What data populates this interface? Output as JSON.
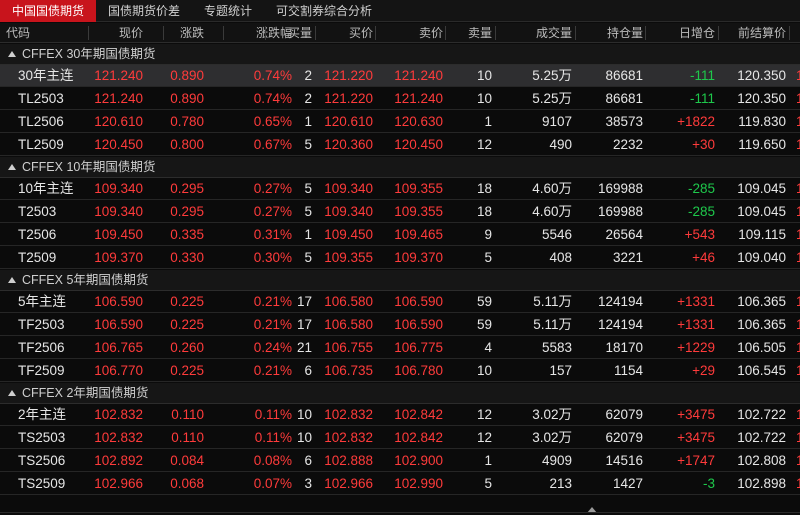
{
  "tabs": [
    {
      "label": "中国国债期货",
      "active": true
    },
    {
      "label": "国债期货价差",
      "active": false
    },
    {
      "label": "专题统计",
      "active": false
    },
    {
      "label": "可交割券综合分析",
      "active": false
    }
  ],
  "columns": [
    "代码",
    "现价",
    "涨跌",
    "涨跌幅",
    "买量",
    "买价",
    "卖价",
    "卖量",
    "成交量",
    "持仓量",
    "日增仓",
    "前结算价"
  ],
  "groups": [
    {
      "name": "CFFEX 30年期国债期货",
      "rows": [
        {
          "code": "30年主连",
          "price": "121.240",
          "chg": "0.890",
          "pct": "0.74%",
          "bidv": "2",
          "bid": "121.220",
          "ask": "121.240",
          "askv": "10",
          "vol": "5.25万",
          "oi": "86681",
          "doi": "-111",
          "prev": "120.350",
          "selected": true
        },
        {
          "code": "TL2503",
          "price": "121.240",
          "chg": "0.890",
          "pct": "0.74%",
          "bidv": "2",
          "bid": "121.220",
          "ask": "121.240",
          "askv": "10",
          "vol": "5.25万",
          "oi": "86681",
          "doi": "-111",
          "prev": "120.350"
        },
        {
          "code": "TL2506",
          "price": "120.610",
          "chg": "0.780",
          "pct": "0.65%",
          "bidv": "1",
          "bid": "120.610",
          "ask": "120.630",
          "askv": "1",
          "vol": "9107",
          "oi": "38573",
          "doi": "+1822",
          "prev": "119.830"
        },
        {
          "code": "TL2509",
          "price": "120.450",
          "chg": "0.800",
          "pct": "0.67%",
          "bidv": "5",
          "bid": "120.360",
          "ask": "120.450",
          "askv": "12",
          "vol": "490",
          "oi": "2232",
          "doi": "+30",
          "prev": "119.650"
        }
      ]
    },
    {
      "name": "CFFEX 10年期国债期货",
      "rows": [
        {
          "code": "10年主连",
          "price": "109.340",
          "chg": "0.295",
          "pct": "0.27%",
          "bidv": "5",
          "bid": "109.340",
          "ask": "109.355",
          "askv": "18",
          "vol": "4.60万",
          "oi": "169988",
          "doi": "-285",
          "prev": "109.045"
        },
        {
          "code": "T2503",
          "price": "109.340",
          "chg": "0.295",
          "pct": "0.27%",
          "bidv": "5",
          "bid": "109.340",
          "ask": "109.355",
          "askv": "18",
          "vol": "4.60万",
          "oi": "169988",
          "doi": "-285",
          "prev": "109.045"
        },
        {
          "code": "T2506",
          "price": "109.450",
          "chg": "0.335",
          "pct": "0.31%",
          "bidv": "1",
          "bid": "109.450",
          "ask": "109.465",
          "askv": "9",
          "vol": "5546",
          "oi": "26564",
          "doi": "+543",
          "prev": "109.115"
        },
        {
          "code": "T2509",
          "price": "109.370",
          "chg": "0.330",
          "pct": "0.30%",
          "bidv": "5",
          "bid": "109.355",
          "ask": "109.370",
          "askv": "5",
          "vol": "408",
          "oi": "3221",
          "doi": "+46",
          "prev": "109.040"
        }
      ]
    },
    {
      "name": "CFFEX 5年期国债期货",
      "rows": [
        {
          "code": "5年主连",
          "price": "106.590",
          "chg": "0.225",
          "pct": "0.21%",
          "bidv": "17",
          "bid": "106.580",
          "ask": "106.590",
          "askv": "59",
          "vol": "5.11万",
          "oi": "124194",
          "doi": "+1331",
          "prev": "106.365"
        },
        {
          "code": "TF2503",
          "price": "106.590",
          "chg": "0.225",
          "pct": "0.21%",
          "bidv": "17",
          "bid": "106.580",
          "ask": "106.590",
          "askv": "59",
          "vol": "5.11万",
          "oi": "124194",
          "doi": "+1331",
          "prev": "106.365"
        },
        {
          "code": "TF2506",
          "price": "106.765",
          "chg": "0.260",
          "pct": "0.24%",
          "bidv": "21",
          "bid": "106.755",
          "ask": "106.775",
          "askv": "4",
          "vol": "5583",
          "oi": "18170",
          "doi": "+1229",
          "prev": "106.505"
        },
        {
          "code": "TF2509",
          "price": "106.770",
          "chg": "0.225",
          "pct": "0.21%",
          "bidv": "6",
          "bid": "106.735",
          "ask": "106.780",
          "askv": "10",
          "vol": "157",
          "oi": "1154",
          "doi": "+29",
          "prev": "106.545"
        }
      ]
    },
    {
      "name": "CFFEX 2年期国债期货",
      "rows": [
        {
          "code": "2年主连",
          "price": "102.832",
          "chg": "0.110",
          "pct": "0.11%",
          "bidv": "10",
          "bid": "102.832",
          "ask": "102.842",
          "askv": "12",
          "vol": "3.02万",
          "oi": "62079",
          "doi": "+3475",
          "prev": "102.722"
        },
        {
          "code": "TS2503",
          "price": "102.832",
          "chg": "0.110",
          "pct": "0.11%",
          "bidv": "10",
          "bid": "102.832",
          "ask": "102.842",
          "askv": "12",
          "vol": "3.02万",
          "oi": "62079",
          "doi": "+3475",
          "prev": "102.722"
        },
        {
          "code": "TS2506",
          "price": "102.892",
          "chg": "0.084",
          "pct": "0.08%",
          "bidv": "6",
          "bid": "102.888",
          "ask": "102.900",
          "askv": "1",
          "vol": "4909",
          "oi": "14516",
          "doi": "+1747",
          "prev": "102.808"
        },
        {
          "code": "TS2509",
          "price": "102.966",
          "chg": "0.068",
          "pct": "0.07%",
          "bidv": "3",
          "bid": "102.966",
          "ask": "102.990",
          "askv": "5",
          "vol": "213",
          "oi": "1427",
          "doi": "-3",
          "prev": "102.898"
        }
      ]
    }
  ],
  "colors": {
    "up": "#ff3b3b",
    "down": "#1ec84b",
    "neutral": "#e6e6e6",
    "accent": "#c8141c"
  }
}
